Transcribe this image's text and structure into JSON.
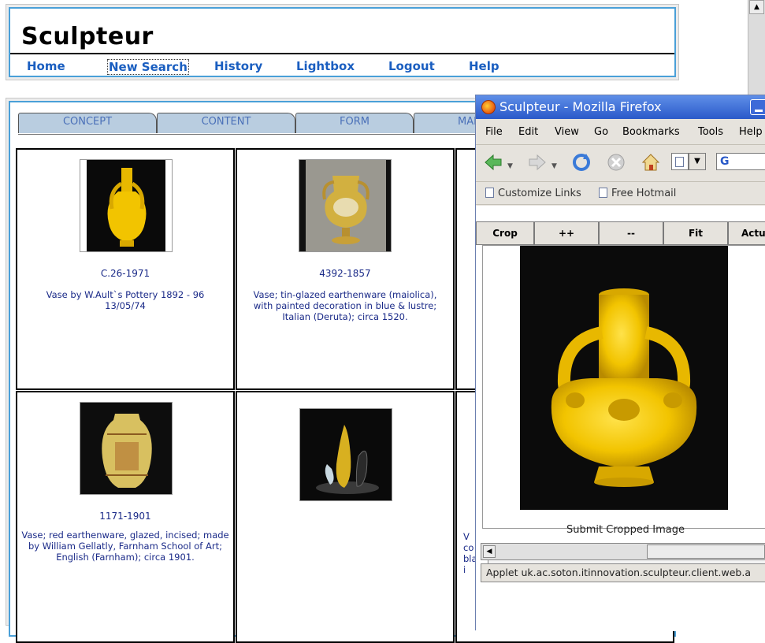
{
  "site": {
    "title": "Sculpteur",
    "nav": [
      "Home",
      "New Search",
      "History",
      "Lightbox",
      "Logout",
      "Help"
    ]
  },
  "tabs": [
    "CONCEPT",
    "CONTENT",
    "FORM",
    "MAP"
  ],
  "results": [
    {
      "id": "C.26-1971",
      "description": "Vase by W.Ault`s Pottery 1892 - 96 13/05/74"
    },
    {
      "id": "4392-1857",
      "description": "Vase; tin-glazed earthenware (maiolica), with painted decoration in blue & lustre; Italian (Deruta); circa 1520."
    },
    {
      "id": "1171-1901",
      "description": "Vase; red earthenware, glazed, incised; made by William Gellatly, Farnham School of Art; English (Farnham); circa 1901."
    },
    {
      "id": "",
      "description": ""
    }
  ],
  "partial_text": {
    "col3_lines": "V\nco\nbla\ni"
  },
  "firefox": {
    "title": "Sculpteur - Mozilla Firefox",
    "menu": [
      "File",
      "Edit",
      "View",
      "Go",
      "Bookmarks",
      "Tools",
      "Help"
    ],
    "links": [
      "Customize Links",
      "Free Hotmail"
    ],
    "crop_buttons": [
      "Crop",
      "++",
      "--",
      "Fit",
      "Actu"
    ],
    "submit_label": "Submit Cropped Image",
    "status": "Applet uk.ac.soton.itinnovation.sculpteur.client.web.a"
  },
  "colors": {
    "accent_blue": "#4aa0d8",
    "nav_blue": "#1a5ec0",
    "text_navy": "#1a2a88",
    "tab_fill": "#b9cde0",
    "vase_yellow": "#f2c400"
  }
}
